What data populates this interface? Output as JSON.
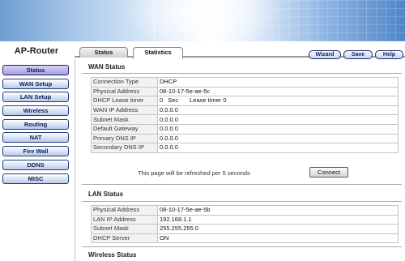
{
  "brand": "AP-Router",
  "tabs": [
    {
      "label": "Status"
    },
    {
      "label": "Statistics"
    }
  ],
  "actions": {
    "wizard": "Wizard",
    "save": "Save",
    "help": "Help"
  },
  "sidebar": {
    "items": [
      {
        "label": "Status"
      },
      {
        "label": "WAN Setup"
      },
      {
        "label": "LAN Setup"
      },
      {
        "label": "Wireless"
      },
      {
        "label": "Routing"
      },
      {
        "label": "NAT"
      },
      {
        "label": "Fire Wall"
      },
      {
        "label": "DDNS"
      },
      {
        "label": "MISC"
      }
    ]
  },
  "wan": {
    "title": "WAN Status",
    "rows": [
      {
        "label": "Connection Type",
        "value": "DHCP"
      },
      {
        "label": "Physical Address",
        "value": "08-10-17-5e-ae-5c"
      },
      {
        "label": "DHCP Lease timer",
        "lease_value": "0",
        "lease_unit": "Sec",
        "lease_timer_label": "Lease timer",
        "lease_timer_value": "0"
      },
      {
        "label": "WAN IP Address",
        "value": "0.0.0.0"
      },
      {
        "label": "Subnet Mask",
        "value": "0.0.0.0"
      },
      {
        "label": "Default Gateway",
        "value": "0.0.0.0"
      },
      {
        "label": "Primary DNS IP",
        "value": "0.0.0.0"
      },
      {
        "label": "Secondary DNS IP",
        "value": "0.0.0.0"
      }
    ],
    "refresh_note": "This page will be refreshed per 5 seconds",
    "connect_label": "Connect"
  },
  "lan": {
    "title": "LAN Status",
    "rows": [
      {
        "label": "Physical Address",
        "value": "08-10-17-5e-ae-5b"
      },
      {
        "label": "LAN IP Address",
        "value": "192.168.1.1"
      },
      {
        "label": "Subnet Mask",
        "value": "255.255.255.0"
      },
      {
        "label": "DHCP Server",
        "value": "ON"
      }
    ]
  },
  "wireless": {
    "title": "Wireless Status"
  }
}
